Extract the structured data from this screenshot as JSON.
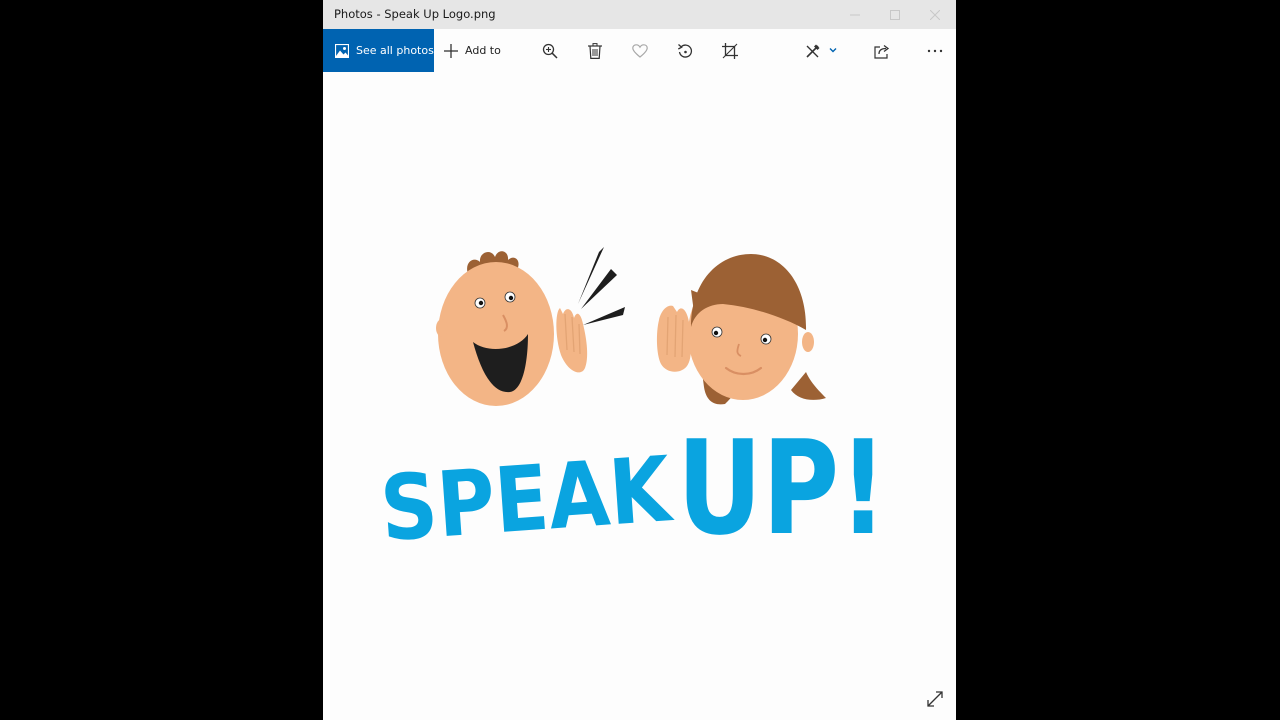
{
  "window": {
    "title": "Photos - Speak Up Logo.png"
  },
  "window_controls": {
    "minimize": "minimize-icon",
    "maximize": "maximize-icon",
    "close": "close-icon"
  },
  "toolbar": {
    "see_all_photos": {
      "label": "See all photos",
      "icon": "photos-icon"
    },
    "add_to": {
      "label": "Add to",
      "icon": "plus-icon"
    },
    "icons": [
      "zoom-icon",
      "delete-icon",
      "heart-icon",
      "rotate-icon",
      "crop-icon",
      "edit-icon",
      "share-icon",
      "more-icon"
    ]
  },
  "image": {
    "logo_text_left": "SPEAK",
    "logo_text_right": "UP!"
  },
  "colors": {
    "accent": "#0063b1",
    "logo_blue": "#0aa4e0",
    "skin": "#f3b586",
    "hair": "#9c6134"
  }
}
